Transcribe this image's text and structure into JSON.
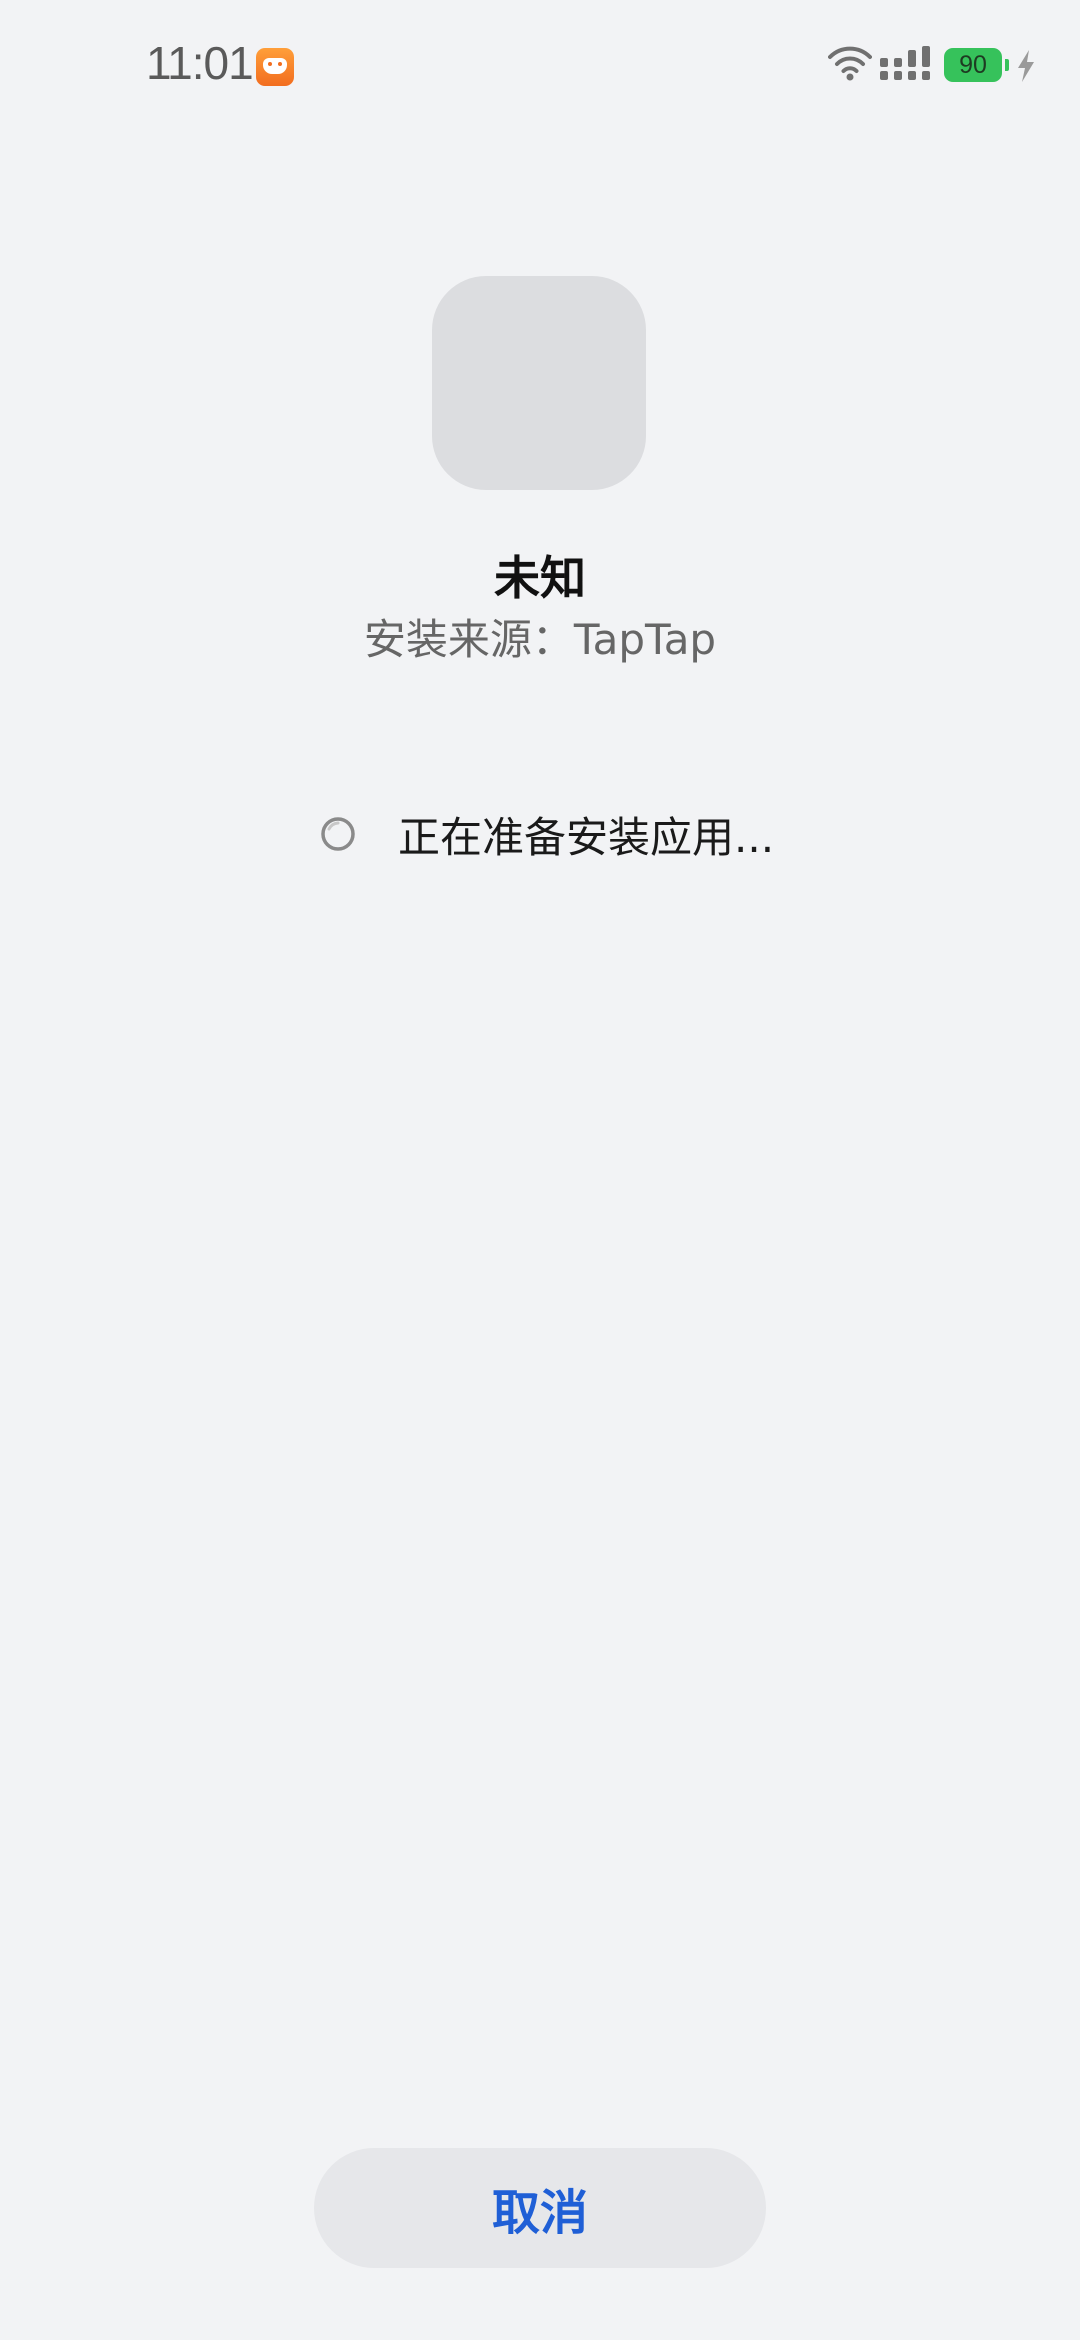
{
  "status_bar": {
    "time": "11:01",
    "notification_icon": "game-controller-icon",
    "wifi_icon": "wifi-icon",
    "signal_icon": "cellular-signal-icon",
    "battery_level": "90",
    "charging_icon": "charging-bolt-icon",
    "battery_color": "#36c25b"
  },
  "app": {
    "name": "未知",
    "source": "安装来源：TapTap"
  },
  "progress": {
    "icon": "loading-spinner-icon",
    "text": "正在准备安装应用..."
  },
  "actions": {
    "cancel_label": "取消",
    "cancel_color": "#1f5fd6"
  }
}
